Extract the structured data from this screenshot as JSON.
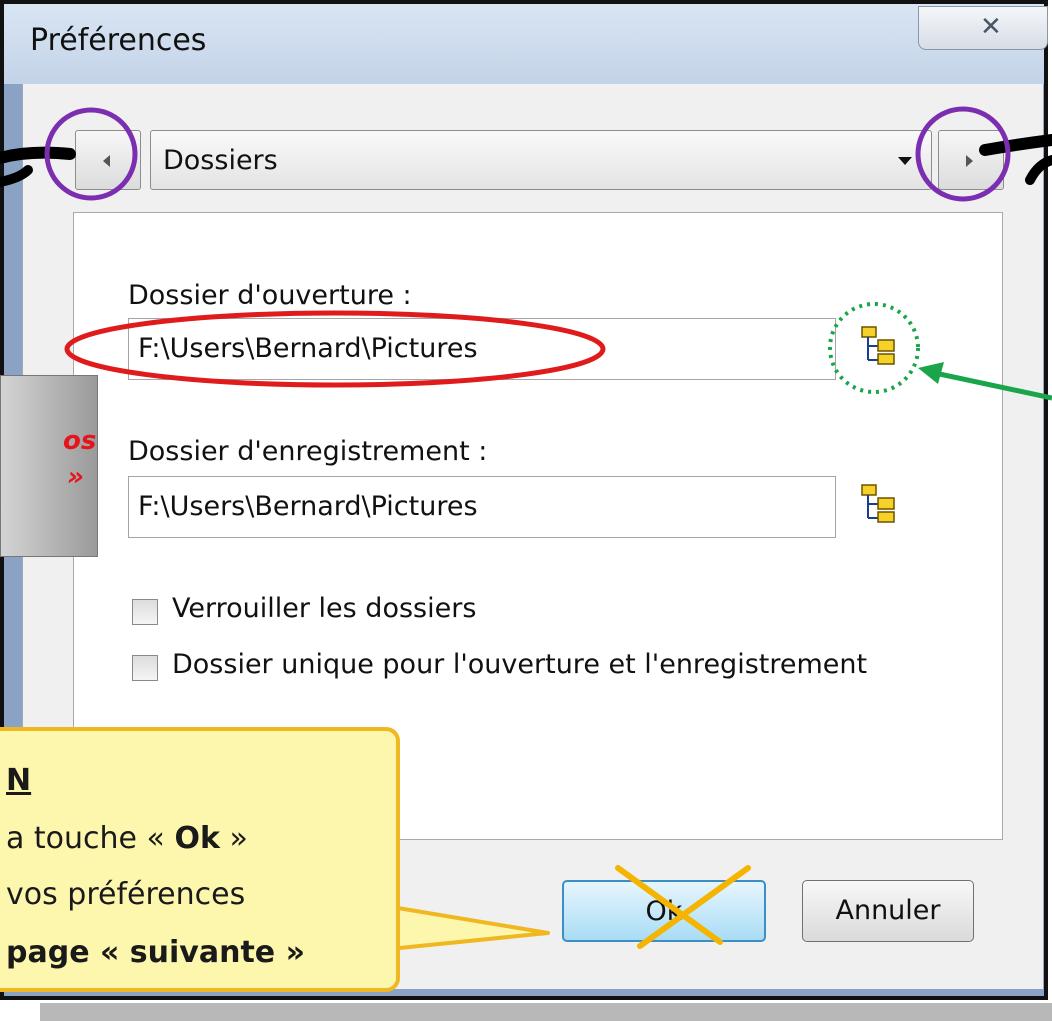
{
  "window": {
    "title": "Préférences",
    "close_glyph": "✕"
  },
  "nav": {
    "prev_icon": "chevron-left-icon",
    "next_icon": "chevron-right-icon",
    "category_selected": "Dossiers"
  },
  "folders": {
    "open_label": "Dossier d'ouverture :",
    "open_value": "F:\\Users\\Bernard\\Pictures",
    "save_label": "Dossier d'enregistrement :",
    "save_value": "F:\\Users\\Bernard\\Pictures",
    "browse_icon": "folder-tree-icon"
  },
  "options": {
    "lock_label": "Verrouiller les dossiers",
    "lock_checked": false,
    "single_label": "Dossier unique pour l'ouverture et l'enregistrement",
    "single_checked": false
  },
  "buttons": {
    "ok": "Ok",
    "cancel": "Annuler"
  },
  "annotations": {
    "side_line1": "os",
    "side_line2": "»",
    "callout_line1": "N",
    "callout_line2_pre": "a touche « ",
    "callout_line2_bold": "Ok",
    "callout_line2_post": " »",
    "callout_line3": "vos préférences",
    "callout_line4": "page « suivante »",
    "colors": {
      "purple_circle": "#7b2fb0",
      "red_ellipse": "#e01b1b",
      "green_arrow": "#1aa54a",
      "yellow_cross": "#f4b400"
    }
  }
}
